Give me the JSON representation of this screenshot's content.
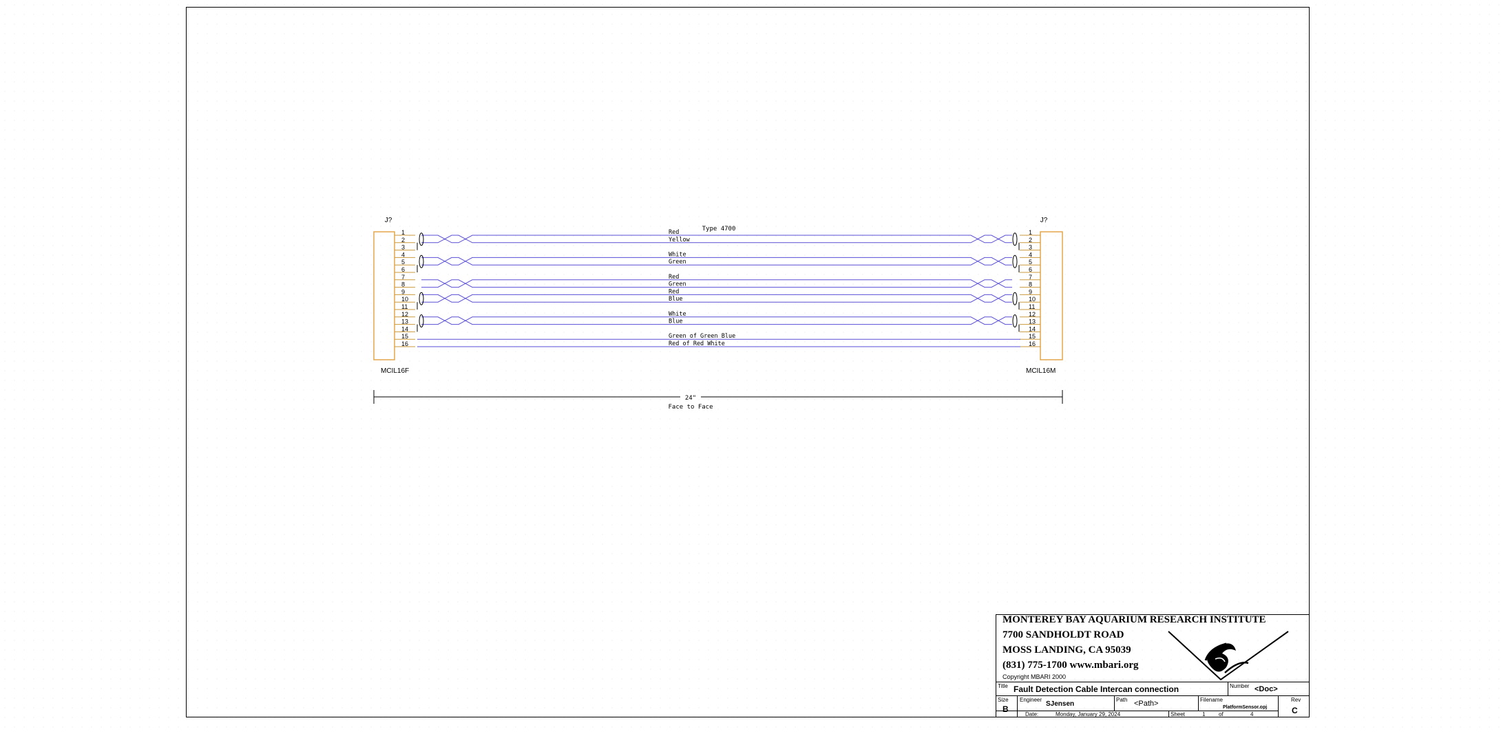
{
  "schematic": {
    "left_connector": {
      "ref": "J?",
      "part": "MCIL16F"
    },
    "right_connector": {
      "ref": "J?",
      "part": "MCIL16M"
    },
    "cable_type": "Type 4700",
    "pins": [
      "1",
      "2",
      "3",
      "4",
      "5",
      "6",
      "7",
      "8",
      "9",
      "10",
      "11",
      "12",
      "13",
      "14",
      "15",
      "16"
    ],
    "wires": [
      {
        "pin": "1",
        "label": "Red",
        "twisted": true
      },
      {
        "pin": "2",
        "label": "Yellow",
        "twisted": true
      },
      {
        "pin": "4",
        "label": "White",
        "twisted": true
      },
      {
        "pin": "5",
        "label": "Green",
        "twisted": true
      },
      {
        "pin": "7",
        "label": "Red",
        "twisted": true
      },
      {
        "pin": "8",
        "label": "Green",
        "twisted": true
      },
      {
        "pin": "9",
        "label": "Red",
        "twisted": true
      },
      {
        "pin": "10",
        "label": "Blue",
        "twisted": true
      },
      {
        "pin": "12",
        "label": "White",
        "twisted": true
      },
      {
        "pin": "13",
        "label": "Blue",
        "twisted": true
      },
      {
        "pin": "15",
        "label": "Green of Green Blue",
        "twisted": false
      },
      {
        "pin": "16",
        "label": "Red of Red White",
        "twisted": false
      }
    ],
    "shields": [
      {
        "pins": [
          "1",
          "3"
        ]
      },
      {
        "pins": [
          "4",
          "6"
        ]
      },
      {
        "pins": [
          "9",
          "11"
        ]
      },
      {
        "pins": [
          "12",
          "14"
        ]
      }
    ],
    "dimension": {
      "length": "24\"",
      "note": "Face to Face"
    },
    "colors": {
      "wire": "#5a4fd6",
      "connector": "#e3a64a",
      "pin_stub": "#cc9a3a",
      "ink": "#000000"
    }
  },
  "title_block": {
    "org_line1": "MONTEREY BAY AQUARIUM RESEARCH INSTITUTE",
    "org_line2": "7700 SANDHOLDT ROAD",
    "org_line3": "MOSS LANDING, CA 95039",
    "org_line4": "(831) 775-1700  www.mbari.org",
    "copyright": "Copyright MBARI 2000",
    "title_label": "Title",
    "title": "Fault Detection Cable Intercan connection",
    "number_label": "Number",
    "number": "<Doc>",
    "size_label": "Size",
    "size": "B",
    "engineer_label": "Engineer",
    "engineer": "SJensen",
    "path_label": "Path",
    "path": "<Path>",
    "filename_label": "Filename",
    "filename": "PlatformSensor.opj",
    "rev_label": "Rev",
    "rev": "C",
    "date_label": "Date:",
    "date": "Monday, January 29, 2024",
    "sheet_label": "Sheet",
    "sheet": "1",
    "of_label": "of",
    "sheet_total": "4",
    "logo_name": "mbari-logo-icon"
  }
}
